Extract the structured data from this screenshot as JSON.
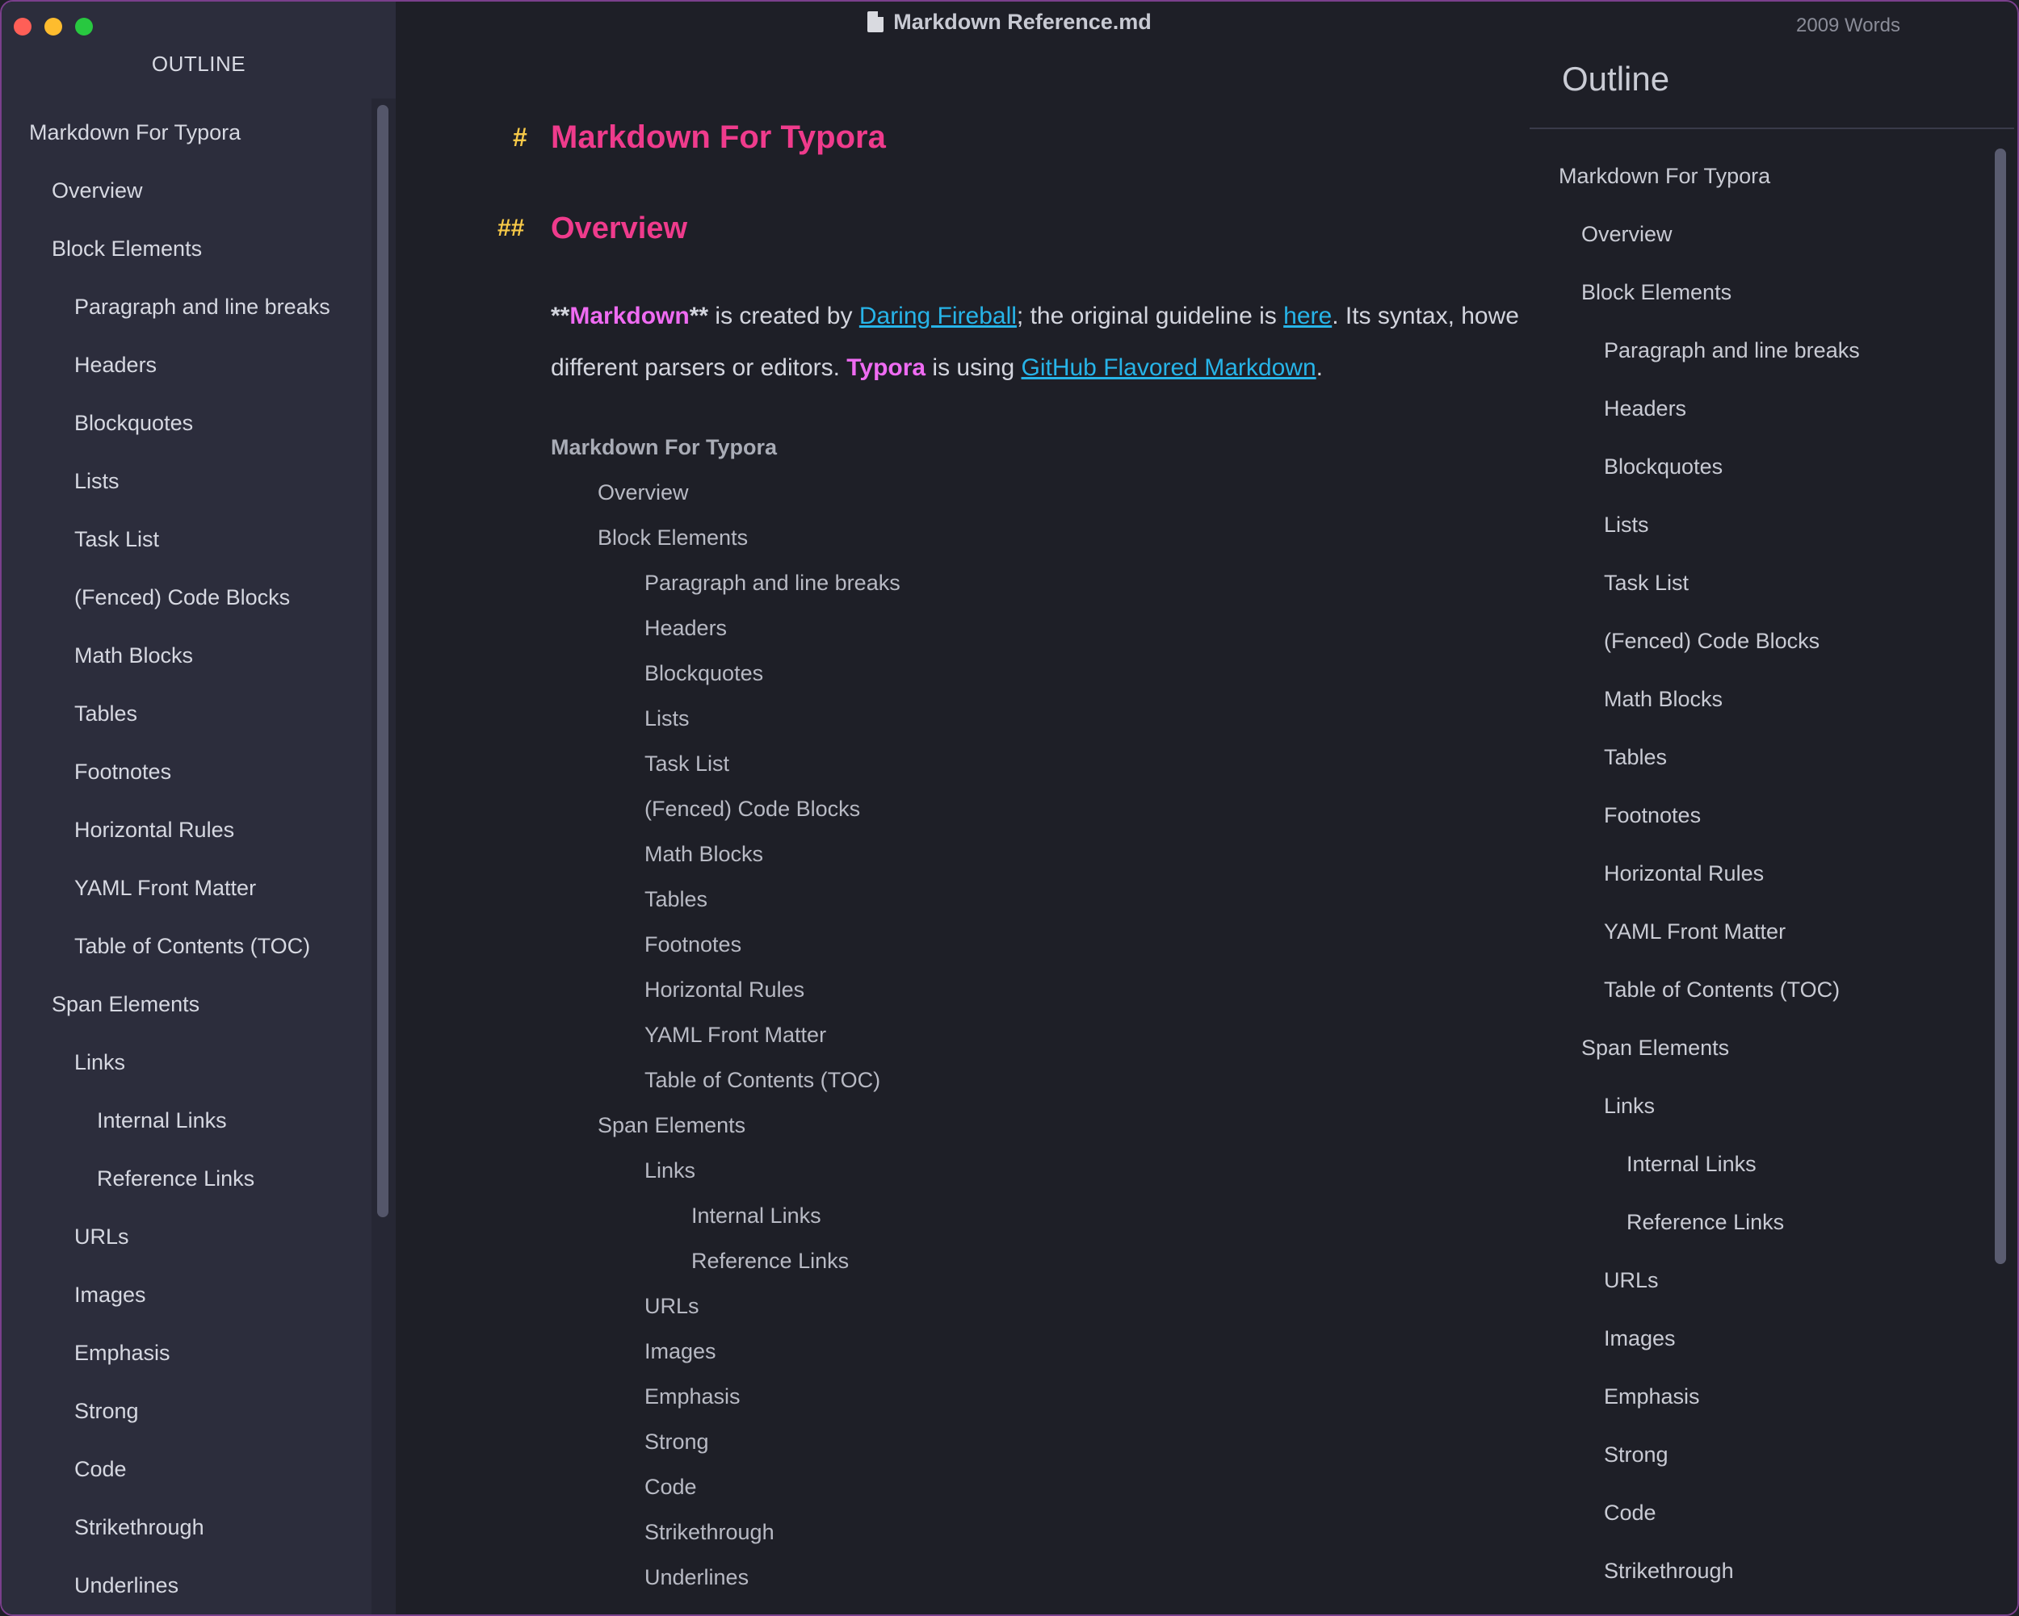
{
  "window": {
    "title": "Markdown Reference.md",
    "word_count": "2009 Words"
  },
  "sidebar": {
    "title": "OUTLINE",
    "items": [
      {
        "label": "Markdown For Typora",
        "level": 1
      },
      {
        "label": "Overview",
        "level": 2
      },
      {
        "label": "Block Elements",
        "level": 2
      },
      {
        "label": "Paragraph and line breaks",
        "level": 3
      },
      {
        "label": "Headers",
        "level": 3
      },
      {
        "label": "Blockquotes",
        "level": 3
      },
      {
        "label": "Lists",
        "level": 3
      },
      {
        "label": "Task List",
        "level": 3
      },
      {
        "label": "(Fenced) Code Blocks",
        "level": 3
      },
      {
        "label": "Math Blocks",
        "level": 3
      },
      {
        "label": "Tables",
        "level": 3
      },
      {
        "label": "Footnotes",
        "level": 3
      },
      {
        "label": "Horizontal Rules",
        "level": 3
      },
      {
        "label": "YAML Front Matter",
        "level": 3
      },
      {
        "label": "Table of Contents (TOC)",
        "level": 3
      },
      {
        "label": "Span Elements",
        "level": 2
      },
      {
        "label": "Links",
        "level": 3
      },
      {
        "label": "Internal Links",
        "level": 4
      },
      {
        "label": "Reference Links",
        "level": 4
      },
      {
        "label": "URLs",
        "level": 3
      },
      {
        "label": "Images",
        "level": 3
      },
      {
        "label": "Emphasis",
        "level": 3
      },
      {
        "label": "Strong",
        "level": 3
      },
      {
        "label": "Code",
        "level": 3
      },
      {
        "label": "Strikethrough",
        "level": 3
      },
      {
        "label": "Underlines",
        "level": 3
      }
    ]
  },
  "editor": {
    "h1_marker": "#",
    "h1": "Markdown For Typora",
    "h2_marker": "##",
    "h2": "Overview",
    "paragraph": {
      "stars_open": "**",
      "bold1": "Markdown",
      "stars_close": "**",
      "text1": " is created by ",
      "link1": "Daring Fireball",
      "text2": "; the original guideline is ",
      "link2": "here",
      "text3": ". Its syntax, howe",
      "text4": "different parsers or editors. ",
      "bold2": "Typora",
      "text5": " is using ",
      "link3": "GitHub Flavored Markdown",
      "text6": "."
    },
    "toc": [
      {
        "label": "Markdown For Typora",
        "level": 1
      },
      {
        "label": "Overview",
        "level": 2
      },
      {
        "label": "Block Elements",
        "level": 2
      },
      {
        "label": "Paragraph and line breaks",
        "level": 3
      },
      {
        "label": "Headers",
        "level": 3
      },
      {
        "label": "Blockquotes",
        "level": 3
      },
      {
        "label": "Lists",
        "level": 3
      },
      {
        "label": "Task List",
        "level": 3
      },
      {
        "label": "(Fenced) Code Blocks",
        "level": 3
      },
      {
        "label": "Math Blocks",
        "level": 3
      },
      {
        "label": "Tables",
        "level": 3
      },
      {
        "label": "Footnotes",
        "level": 3
      },
      {
        "label": "Horizontal Rules",
        "level": 3
      },
      {
        "label": "YAML Front Matter",
        "level": 3
      },
      {
        "label": "Table of Contents (TOC)",
        "level": 3
      },
      {
        "label": "Span Elements",
        "level": 2
      },
      {
        "label": "Links",
        "level": 3
      },
      {
        "label": "Internal Links",
        "level": 4
      },
      {
        "label": "Reference Links",
        "level": 4
      },
      {
        "label": "URLs",
        "level": 3
      },
      {
        "label": "Images",
        "level": 3
      },
      {
        "label": "Emphasis",
        "level": 3
      },
      {
        "label": "Strong",
        "level": 3
      },
      {
        "label": "Code",
        "level": 3
      },
      {
        "label": "Strikethrough",
        "level": 3
      },
      {
        "label": "Underlines",
        "level": 3
      }
    ]
  },
  "outline_panel": {
    "title": "Outline",
    "items": [
      {
        "label": "Markdown For Typora",
        "level": 1
      },
      {
        "label": "Overview",
        "level": 2
      },
      {
        "label": "Block Elements",
        "level": 2
      },
      {
        "label": "Paragraph and line breaks",
        "level": 3
      },
      {
        "label": "Headers",
        "level": 3
      },
      {
        "label": "Blockquotes",
        "level": 3
      },
      {
        "label": "Lists",
        "level": 3
      },
      {
        "label": "Task List",
        "level": 3
      },
      {
        "label": "(Fenced) Code Blocks",
        "level": 3
      },
      {
        "label": "Math Blocks",
        "level": 3
      },
      {
        "label": "Tables",
        "level": 3
      },
      {
        "label": "Footnotes",
        "level": 3
      },
      {
        "label": "Horizontal Rules",
        "level": 3
      },
      {
        "label": "YAML Front Matter",
        "level": 3
      },
      {
        "label": "Table of Contents (TOC)",
        "level": 3
      },
      {
        "label": "Span Elements",
        "level": 2
      },
      {
        "label": "Links",
        "level": 3
      },
      {
        "label": "Internal Links",
        "level": 4
      },
      {
        "label": "Reference Links",
        "level": 4
      },
      {
        "label": "URLs",
        "level": 3
      },
      {
        "label": "Images",
        "level": 3
      },
      {
        "label": "Emphasis",
        "level": 3
      },
      {
        "label": "Strong",
        "level": 3
      },
      {
        "label": "Code",
        "level": 3
      },
      {
        "label": "Strikethrough",
        "level": 3
      }
    ]
  },
  "colors": {
    "heading": "#ef3b8c",
    "heading_marker": "#f7c948",
    "link": "#27b4e8",
    "strong": "#ef6bf2",
    "sidebar_bg": "#2c2d3c",
    "editor_bg": "#1e1f27"
  },
  "icons": {
    "close": "close-button-icon",
    "minimize": "minimize-button-icon",
    "zoom": "zoom-button-icon",
    "file": "markdown-file-icon"
  }
}
